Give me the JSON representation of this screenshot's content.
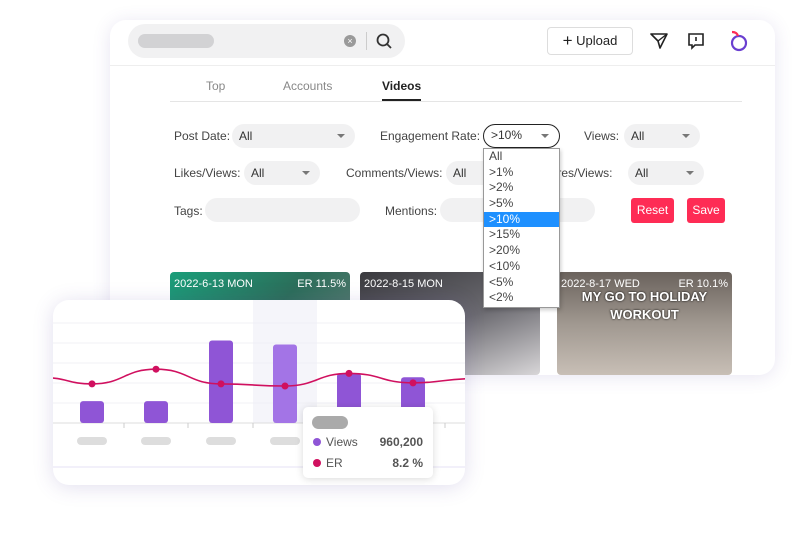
{
  "header": {
    "search_clear_icon": "x-circle-icon",
    "search_icon": "magnifier-icon",
    "upload_label": "Upload",
    "icons": [
      "send-icon",
      "message-icon",
      "profile-icon"
    ]
  },
  "tabs": [
    {
      "label": "Top"
    },
    {
      "label": "Accounts"
    },
    {
      "label": "Videos",
      "active": true
    }
  ],
  "filters": {
    "post_date": {
      "label": "Post Date:",
      "value": "All"
    },
    "engagement_rate": {
      "label": "Engagement Rate:",
      "value": ">10%",
      "options": [
        "All",
        ">1%",
        ">2%",
        ">5%",
        ">10%",
        ">15%",
        ">20%",
        "<10%",
        "<5%",
        "<2%"
      ]
    },
    "views": {
      "label": "Views:",
      "value": "All"
    },
    "likes_views": {
      "label": "Likes/Views:",
      "value": "All"
    },
    "comments_views": {
      "label": "Comments/Views:",
      "value": "All"
    },
    "shares_views": {
      "label": "Shares/Views:",
      "value": "All"
    },
    "tags": {
      "label": "Tags:",
      "value": ""
    },
    "mentions": {
      "label": "Mentions:",
      "value": ""
    },
    "reset_label": "Reset",
    "save_label": "Save"
  },
  "videos": [
    {
      "date": "2022-6-13 MON",
      "er": "ER 11.5%"
    },
    {
      "date": "2022-8-15 MON",
      "er": ""
    },
    {
      "date": "2022-8-17 WED",
      "er": "ER 10.1%",
      "caption": "MY GO TO HOLIDAY WORKOUT"
    }
  ],
  "colors": {
    "accent": "#fe2c55",
    "views": "#8f55d6",
    "er": "#d0105f",
    "selected_option": "#1e90ff"
  },
  "chart_data": {
    "type": "bar",
    "series": [
      {
        "name": "Views",
        "values": [
          267000,
          267000,
          1009000,
          960200,
          608000,
          559000
        ]
      },
      {
        "name": "ER",
        "type": "line",
        "values": [
          8.4,
          9.8,
          8.4,
          8.2,
          9.4,
          8.5
        ]
      }
    ],
    "highlighted_index": 3,
    "tooltip": {
      "views_label": "Views",
      "views_value": "960,200",
      "er_label": "ER",
      "er_value": "8.2 %"
    }
  }
}
